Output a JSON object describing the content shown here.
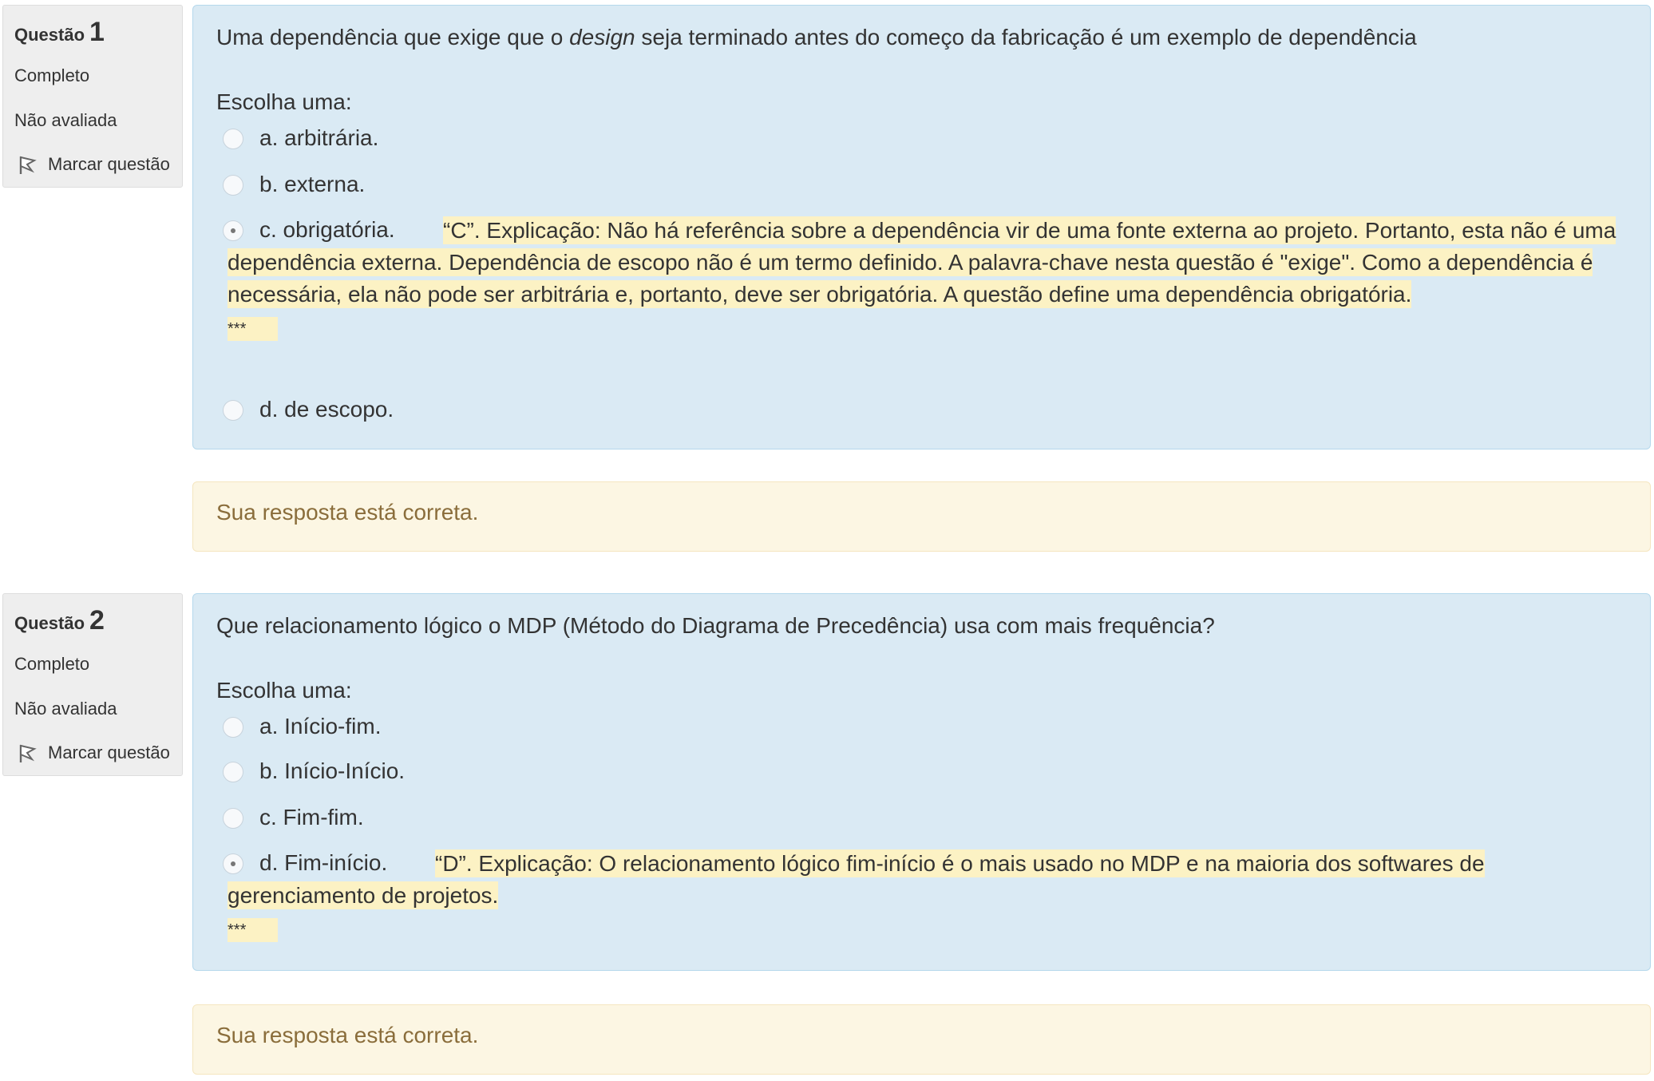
{
  "questions": [
    {
      "label": "Questão",
      "number": "1",
      "state": "Completo",
      "grade": "Não avaliada",
      "flag_label": "Marcar questão",
      "text_before": "Uma dependência que exige que o ",
      "text_em": "design",
      "text_after": " seja terminado antes do começo da fabricação é um exemplo de dependência",
      "prompt": "Escolha uma:",
      "options": [
        {
          "label": "a. arbitrária.",
          "selected": false
        },
        {
          "label": "b. externa.",
          "selected": false
        },
        {
          "label": "c. obrigatória.",
          "selected": true
        },
        {
          "label": "d. de escopo.",
          "selected": false
        }
      ],
      "feedback": "“C”. Explicação: Não há referência sobre a dependência vir de uma fonte externa ao projeto. Portanto, esta não é uma dependência externa. Dependência de escopo não é um termo definido. A palavra-chave nesta questão é \"exige\". Como a dependência é necessária, ela não pode ser arbitrária e, portanto, deve ser obrigatória. A questão define uma dependência obrigatória.",
      "feedback_stars": "***",
      "outcome": "Sua resposta está correta."
    },
    {
      "label": "Questão",
      "number": "2",
      "state": "Completo",
      "grade": "Não avaliada",
      "flag_label": "Marcar questão",
      "text": "Que relacionamento lógico o MDP (Método do Diagrama de Precedência) usa com mais frequência?",
      "prompt": "Escolha uma:",
      "options": [
        {
          "label": "a. Início-fim.",
          "selected": false
        },
        {
          "label": "b. Início-Início.",
          "selected": false
        },
        {
          "label": "c. Fim-fim.",
          "selected": false
        },
        {
          "label": "d. Fim-início.",
          "selected": true
        }
      ],
      "feedback": "“D”. Explicação: O relacionamento lógico fim-início é o mais usado no MDP e na maioria dos softwares de gerenciamento de projetos.",
      "feedback_stars": "***",
      "outcome": "Sua resposta está correta."
    }
  ]
}
